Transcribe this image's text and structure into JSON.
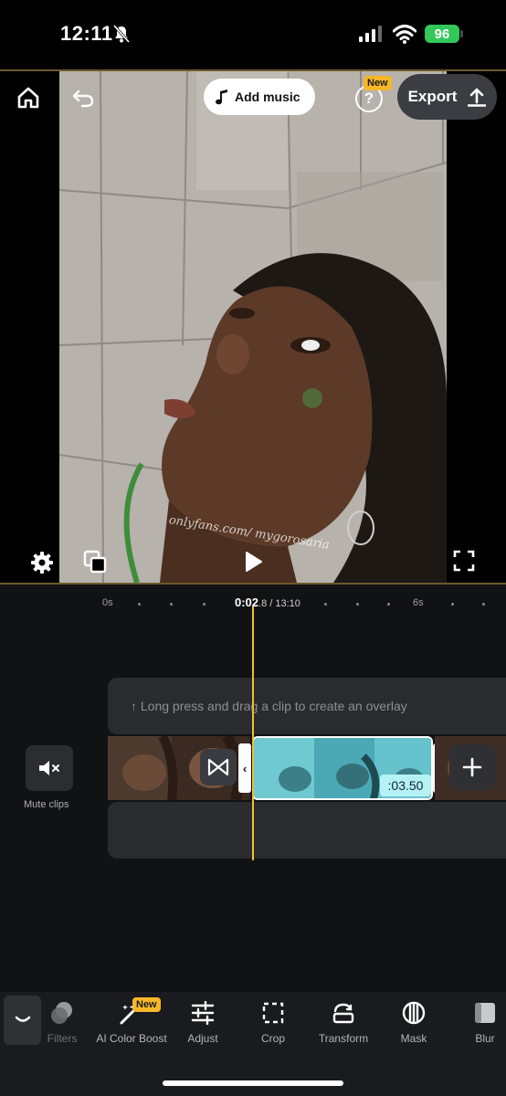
{
  "status_bar": {
    "time": "12:11",
    "battery": "96"
  },
  "preview": {
    "add_music_label": "Add music",
    "new_badge": "New",
    "export_label": "Export",
    "watermark": "onlyfans.com/ mygorosaria"
  },
  "timeline": {
    "ruler_start": "0s",
    "ruler_end": "6s",
    "current_time": "0:02",
    "current_time_sub": ".8 / 13:10",
    "overlay_hint": "↑ Long press and drag a clip to create an overlay",
    "selected_clip_duration": ":03.50",
    "mute_label": "Mute clips"
  },
  "toolbar": {
    "new_badge": "New",
    "items": [
      {
        "label": "Filters",
        "icon": "filters-icon"
      },
      {
        "label": "AI Color Boost",
        "icon": "ai-color-boost-icon"
      },
      {
        "label": "Adjust",
        "icon": "adjust-sliders-icon"
      },
      {
        "label": "Crop",
        "icon": "crop-icon"
      },
      {
        "label": "Transform",
        "icon": "transform-icon"
      },
      {
        "label": "Mask",
        "icon": "mask-icon"
      },
      {
        "label": "Blur",
        "icon": "blur-icon"
      }
    ]
  },
  "colors": {
    "accent": "#f3c02a",
    "battery": "#34c759",
    "duration_tag": "#b5f2f5",
    "badge": "#f7b728"
  }
}
